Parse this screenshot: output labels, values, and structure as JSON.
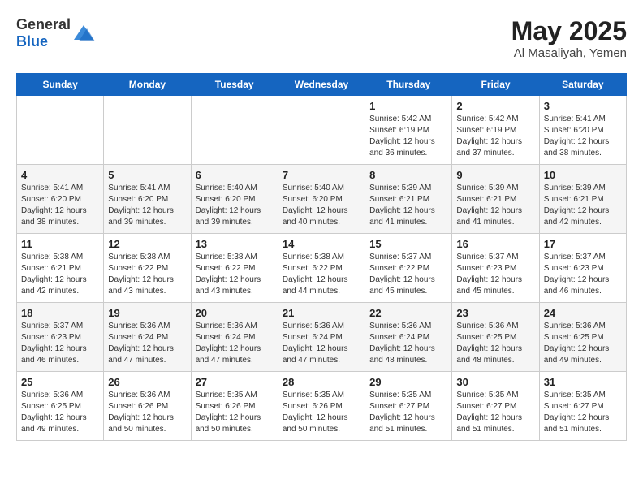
{
  "header": {
    "logo_general": "General",
    "logo_blue": "Blue",
    "month_year": "May 2025",
    "location": "Al Masaliyah, Yemen"
  },
  "days_of_week": [
    "Sunday",
    "Monday",
    "Tuesday",
    "Wednesday",
    "Thursday",
    "Friday",
    "Saturday"
  ],
  "weeks": [
    [
      {
        "day": "",
        "content": ""
      },
      {
        "day": "",
        "content": ""
      },
      {
        "day": "",
        "content": ""
      },
      {
        "day": "",
        "content": ""
      },
      {
        "day": "1",
        "content": "Sunrise: 5:42 AM\nSunset: 6:19 PM\nDaylight: 12 hours\nand 36 minutes."
      },
      {
        "day": "2",
        "content": "Sunrise: 5:42 AM\nSunset: 6:19 PM\nDaylight: 12 hours\nand 37 minutes."
      },
      {
        "day": "3",
        "content": "Sunrise: 5:41 AM\nSunset: 6:20 PM\nDaylight: 12 hours\nand 38 minutes."
      }
    ],
    [
      {
        "day": "4",
        "content": "Sunrise: 5:41 AM\nSunset: 6:20 PM\nDaylight: 12 hours\nand 38 minutes."
      },
      {
        "day": "5",
        "content": "Sunrise: 5:41 AM\nSunset: 6:20 PM\nDaylight: 12 hours\nand 39 minutes."
      },
      {
        "day": "6",
        "content": "Sunrise: 5:40 AM\nSunset: 6:20 PM\nDaylight: 12 hours\nand 39 minutes."
      },
      {
        "day": "7",
        "content": "Sunrise: 5:40 AM\nSunset: 6:20 PM\nDaylight: 12 hours\nand 40 minutes."
      },
      {
        "day": "8",
        "content": "Sunrise: 5:39 AM\nSunset: 6:21 PM\nDaylight: 12 hours\nand 41 minutes."
      },
      {
        "day": "9",
        "content": "Sunrise: 5:39 AM\nSunset: 6:21 PM\nDaylight: 12 hours\nand 41 minutes."
      },
      {
        "day": "10",
        "content": "Sunrise: 5:39 AM\nSunset: 6:21 PM\nDaylight: 12 hours\nand 42 minutes."
      }
    ],
    [
      {
        "day": "11",
        "content": "Sunrise: 5:38 AM\nSunset: 6:21 PM\nDaylight: 12 hours\nand 42 minutes."
      },
      {
        "day": "12",
        "content": "Sunrise: 5:38 AM\nSunset: 6:22 PM\nDaylight: 12 hours\nand 43 minutes."
      },
      {
        "day": "13",
        "content": "Sunrise: 5:38 AM\nSunset: 6:22 PM\nDaylight: 12 hours\nand 43 minutes."
      },
      {
        "day": "14",
        "content": "Sunrise: 5:38 AM\nSunset: 6:22 PM\nDaylight: 12 hours\nand 44 minutes."
      },
      {
        "day": "15",
        "content": "Sunrise: 5:37 AM\nSunset: 6:22 PM\nDaylight: 12 hours\nand 45 minutes."
      },
      {
        "day": "16",
        "content": "Sunrise: 5:37 AM\nSunset: 6:23 PM\nDaylight: 12 hours\nand 45 minutes."
      },
      {
        "day": "17",
        "content": "Sunrise: 5:37 AM\nSunset: 6:23 PM\nDaylight: 12 hours\nand 46 minutes."
      }
    ],
    [
      {
        "day": "18",
        "content": "Sunrise: 5:37 AM\nSunset: 6:23 PM\nDaylight: 12 hours\nand 46 minutes."
      },
      {
        "day": "19",
        "content": "Sunrise: 5:36 AM\nSunset: 6:24 PM\nDaylight: 12 hours\nand 47 minutes."
      },
      {
        "day": "20",
        "content": "Sunrise: 5:36 AM\nSunset: 6:24 PM\nDaylight: 12 hours\nand 47 minutes."
      },
      {
        "day": "21",
        "content": "Sunrise: 5:36 AM\nSunset: 6:24 PM\nDaylight: 12 hours\nand 47 minutes."
      },
      {
        "day": "22",
        "content": "Sunrise: 5:36 AM\nSunset: 6:24 PM\nDaylight: 12 hours\nand 48 minutes."
      },
      {
        "day": "23",
        "content": "Sunrise: 5:36 AM\nSunset: 6:25 PM\nDaylight: 12 hours\nand 48 minutes."
      },
      {
        "day": "24",
        "content": "Sunrise: 5:36 AM\nSunset: 6:25 PM\nDaylight: 12 hours\nand 49 minutes."
      }
    ],
    [
      {
        "day": "25",
        "content": "Sunrise: 5:36 AM\nSunset: 6:25 PM\nDaylight: 12 hours\nand 49 minutes."
      },
      {
        "day": "26",
        "content": "Sunrise: 5:36 AM\nSunset: 6:26 PM\nDaylight: 12 hours\nand 50 minutes."
      },
      {
        "day": "27",
        "content": "Sunrise: 5:35 AM\nSunset: 6:26 PM\nDaylight: 12 hours\nand 50 minutes."
      },
      {
        "day": "28",
        "content": "Sunrise: 5:35 AM\nSunset: 6:26 PM\nDaylight: 12 hours\nand 50 minutes."
      },
      {
        "day": "29",
        "content": "Sunrise: 5:35 AM\nSunset: 6:27 PM\nDaylight: 12 hours\nand 51 minutes."
      },
      {
        "day": "30",
        "content": "Sunrise: 5:35 AM\nSunset: 6:27 PM\nDaylight: 12 hours\nand 51 minutes."
      },
      {
        "day": "31",
        "content": "Sunrise: 5:35 AM\nSunset: 6:27 PM\nDaylight: 12 hours\nand 51 minutes."
      }
    ]
  ]
}
